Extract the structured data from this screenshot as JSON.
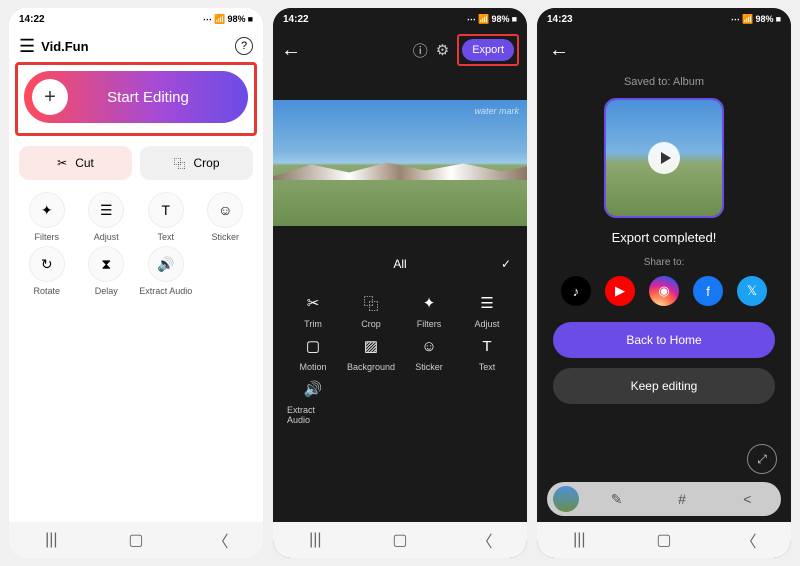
{
  "phone1": {
    "status_time": "14:22",
    "status_right": "98%",
    "app_title": "Vid.Fun",
    "start_label": "Start Editing",
    "tools": {
      "cut": "Cut",
      "crop": "Crop"
    },
    "grid": [
      {
        "label": "Filters"
      },
      {
        "label": "Adjust"
      },
      {
        "label": "Text"
      },
      {
        "label": "Sticker"
      },
      {
        "label": "Rotate"
      },
      {
        "label": "Delay"
      },
      {
        "label": "Extract Audio"
      }
    ]
  },
  "phone2": {
    "status_time": "14:22",
    "status_right": "98%",
    "export_label": "Export",
    "watermark": "water mark",
    "tab_all": "All",
    "grid": [
      {
        "label": "Trim"
      },
      {
        "label": "Crop"
      },
      {
        "label": "Filters"
      },
      {
        "label": "Adjust"
      },
      {
        "label": "Motion"
      },
      {
        "label": "Background"
      },
      {
        "label": "Sticker"
      },
      {
        "label": "Text"
      },
      {
        "label": "Extract Audio"
      }
    ]
  },
  "phone3": {
    "status_time": "14:23",
    "status_right": "98%",
    "saved_to": "Saved to: Album",
    "completed": "Export completed!",
    "share_to": "Share to:",
    "back_home": "Back to Home",
    "keep_editing": "Keep editing"
  }
}
